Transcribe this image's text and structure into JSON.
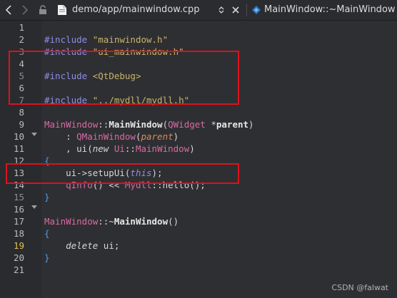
{
  "toolbar": {
    "file": "demo/app/mainwindow.cpp",
    "function": "MainWindow::~MainWindow"
  },
  "lines": [
    {
      "n": "1"
    },
    {
      "n": "2"
    },
    {
      "n": "3"
    },
    {
      "n": "4"
    },
    {
      "n": "5"
    },
    {
      "n": "6"
    },
    {
      "n": "7"
    },
    {
      "n": "8"
    },
    {
      "n": "9"
    },
    {
      "n": "10"
    },
    {
      "n": "11"
    },
    {
      "n": "12"
    },
    {
      "n": "13"
    },
    {
      "n": "14"
    },
    {
      "n": "15"
    },
    {
      "n": "16"
    },
    {
      "n": "17"
    },
    {
      "n": "18"
    },
    {
      "n": "19"
    },
    {
      "n": "20"
    },
    {
      "n": "21"
    }
  ],
  "code": {
    "l1": {
      "kw": "#include",
      "str": " \"mainwindow.h\""
    },
    "l2": {
      "kw": "#include",
      "str": " \"ui_mainwindow.h\""
    },
    "l4": {
      "kw": "#include",
      "str": " <QtDebug>"
    },
    "l6": {
      "kw": "#include",
      "str": " \"../mydll/mydll.h\""
    },
    "l8": {
      "cls": "MainWindow",
      "sep": "::",
      "fn": "MainWindow",
      "open": "(",
      "type": "QWidget",
      "star": " *",
      "param": "parent",
      "close": ")"
    },
    "l9": {
      "lead": "    : ",
      "cls": "QMainWindow",
      "open": "(",
      "param": "parent",
      "close": ")"
    },
    "l10": {
      "lead": "    , ui(",
      "new": "new",
      "sp": " ",
      "cls": "Ui",
      "sep": "::",
      "cls2": "MainWindow",
      "close": ")"
    },
    "l11": {
      "brace": "{"
    },
    "l12": {
      "lead": "    ui->setupUi(",
      "this": "this",
      "close": ");"
    },
    "l13": {
      "lead": "    ",
      "q": "qInfo",
      "mid": "() << ",
      "cls": "Mydll",
      "rest": "::hello();"
    },
    "l14": {
      "brace": "}"
    },
    "l16": {
      "cls": "MainWindow",
      "sep": "::~",
      "fn": "MainWindow",
      "rest": "()"
    },
    "l17": {
      "brace": "{"
    },
    "l18": {
      "lead": "    ",
      "kw": "delete",
      "rest": " ui;"
    },
    "l19": {
      "brace": "}"
    }
  },
  "watermark": "CSDN @falwat"
}
